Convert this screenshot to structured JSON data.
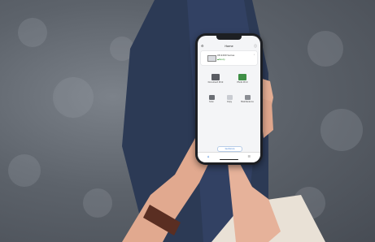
{
  "app": {
    "header_title": "Home",
    "printer_name": "XP-2200 Series",
    "printer_status": "Ready",
    "bottom_button": "Guidance"
  },
  "tiles": [
    {
      "label": "Document Print"
    },
    {
      "label": "Photo Print"
    },
    {
      "label": "Scan"
    },
    {
      "label": "Copy"
    },
    {
      "label": "Maintenance"
    }
  ],
  "colors": {
    "accent": "#3b7bd4",
    "status_ok": "#3a9a3a",
    "rug": "#5d636b",
    "denim": "#2c3a55",
    "watch_strap": "#5a2e22"
  },
  "icons": {
    "header_left": "gear-icon",
    "header_right": "info-icon",
    "tab_home": "home-icon",
    "tab_other": "list-icon"
  }
}
